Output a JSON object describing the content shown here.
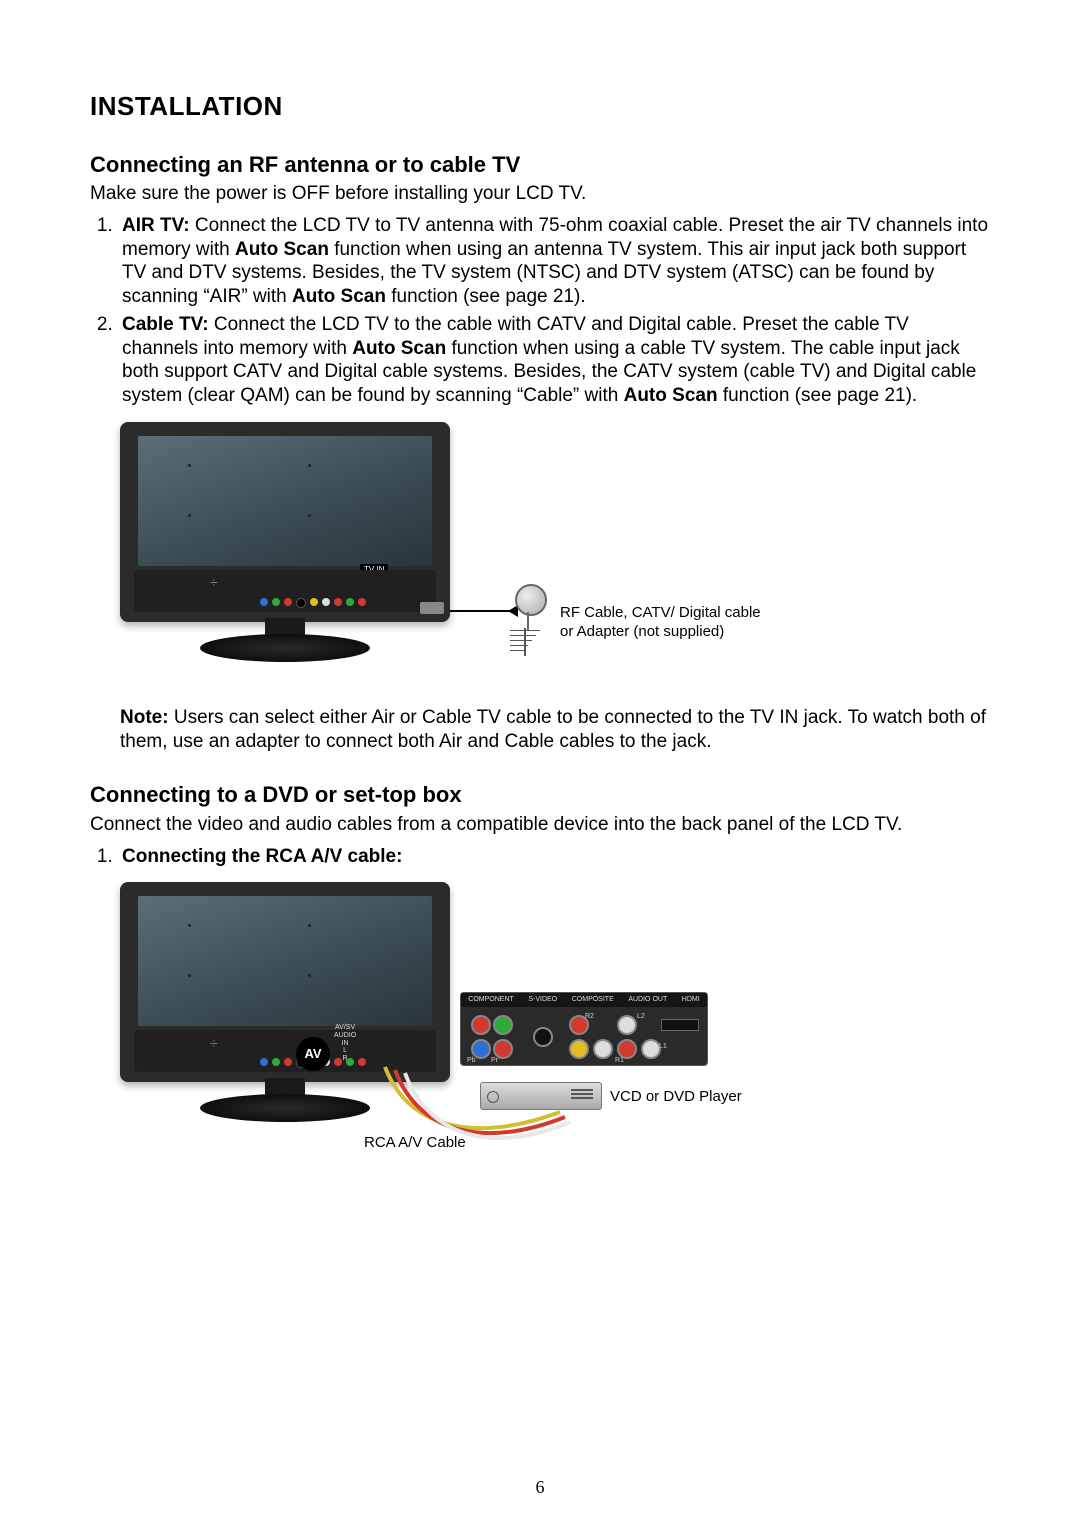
{
  "page_number": "6",
  "h1": "INSTALLATION",
  "section1": {
    "heading": "Connecting an RF antenna or to cable TV",
    "intro": "Make sure the power is OFF before installing your LCD TV.",
    "items": [
      {
        "lead": "AIR TV:",
        "text_before_bold1": " Connect the LCD TV to TV antenna with 75-ohm coaxial cable. Preset the air TV channels into memory with ",
        "bold1": "Auto Scan",
        "text_mid": " function when using an antenna TV system. This air input jack both support TV and DTV systems. Besides, the TV system (NTSC) and DTV system (ATSC) can be found by scanning “AIR” with ",
        "bold2": "Auto Scan",
        "text_after": " function (see page 21)."
      },
      {
        "lead": "Cable TV:",
        "text_before_bold1": " Connect the LCD TV to the cable with CATV and Digital cable. Preset the cable TV channels into memory with ",
        "bold1": "Auto Scan",
        "text_mid": " function when using a cable TV system. The cable input jack both support CATV and Digital cable systems. Besides, the CATV system (cable TV) and Digital cable system (clear QAM) can be found by scanning “Cable” with ",
        "bold2": "Auto Scan",
        "text_after": " function (see page 21)."
      }
    ],
    "figure": {
      "tv_in_label": "TV IN",
      "caption_line1": "RF Cable, CATV/ Digital cable",
      "caption_line2": "or Adapter (not supplied)"
    },
    "note_lead": "Note:",
    "note_text": " Users can select either Air or Cable TV cable to be connected to the TV IN jack. To watch both of them, use an adapter to connect both Air and Cable cables to the jack."
  },
  "section2": {
    "heading": "Connecting to a DVD or set-top box",
    "intro": "Connect the video and audio cables from a compatible device into the back panel of the LCD TV.",
    "item1_lead": "Connecting the RCA A/V cable:",
    "figure": {
      "av_badge": "AV",
      "av_sub": "AV/SV\nAUDIO\nIN\nL\nR",
      "panel_labels": [
        "COMPONENT",
        "S-VIDEO",
        "COMPOSITE",
        "AUDIO OUT",
        "HDMI"
      ],
      "jack_labels": {
        "r2": "R2",
        "l2": "L2",
        "pb": "Pb",
        "pr": "Pr",
        "r1": "R1",
        "l1": "L1"
      },
      "dvd_caption": "VCD or DVD Player",
      "rca_caption": "RCA A/V Cable"
    }
  }
}
